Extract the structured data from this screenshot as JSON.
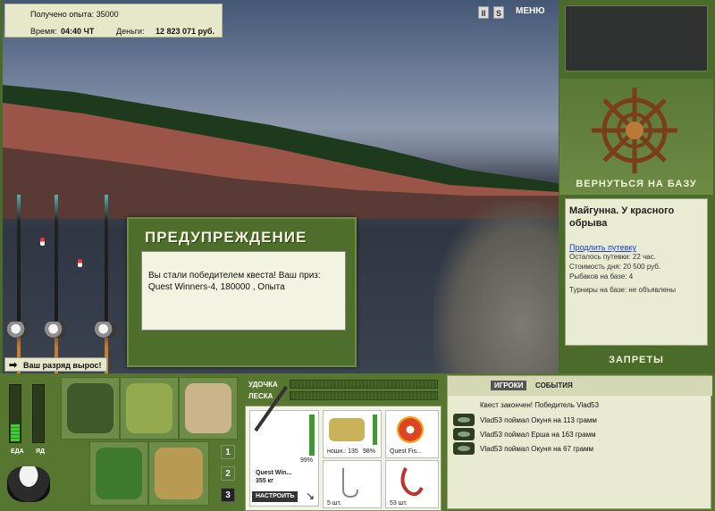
{
  "hud": {
    "experience_label": "Получено опыта: 35000",
    "time_label": "Время:",
    "time_value": "04:40 ЧТ",
    "money_label": "Деньги:",
    "money_value": "12 823 071 руб.",
    "pause_icon": "pause-icon",
    "sound_icon": "sound-icon",
    "menu_label": "МЕНЮ"
  },
  "rank_message": "Ваш разряд вырос!",
  "dialog": {
    "title": "ПРЕДУПРЕЖДЕНИЕ",
    "message": "Вы стали победителем квеста! Ваш приз: Quest Winners-4, 180000 , Опыта"
  },
  "right_panel": {
    "return_label": "ВЕРНУТЬСЯ НА БАЗУ",
    "place_name": "Майгунна. У красного обрыва",
    "extend_link": "Продлить путевку",
    "remaining": "Осталось путевки: 22 час.",
    "day_cost": "Стоимость дня: 20 500 руб.",
    "fishers": "Рыбаков на базе: 4",
    "tournaments": "Турниры на базе: не объявлены",
    "restrictions_label": "ЗАПРЕТЫ"
  },
  "meters": {
    "food_label": "ЕДА",
    "poison_label": "ЯД",
    "food_level": 0.3,
    "poison_level": 0
  },
  "pages": [
    "1",
    "2",
    "3"
  ],
  "active_page": "3",
  "tackle": {
    "rod_label": "УДОЧКА",
    "line_label": "ЛЕСКА",
    "rod_name": "Quest Win...",
    "rod_weight": "355 кг",
    "rod_percent": "99%",
    "reel_label": "ношн.: 135",
    "reel_percent": "98%",
    "line_name": "Quest Fis...",
    "hook_count": "5 шт.",
    "bait_count": "53 шт.",
    "setup_button": "НАСТРОИТЬ"
  },
  "chat": {
    "tab_players": "ИГРОКИ",
    "tab_events": "СОБЫТИЯ",
    "lines": [
      "Квест закончен! Победитель Vlad53",
      "Vlad53 поймал Окуня на 113 грамм",
      "Vlad53 поймал Ерша на 163 грамм",
      "Vlad53 поймал Окуня на 67 грамм"
    ]
  }
}
